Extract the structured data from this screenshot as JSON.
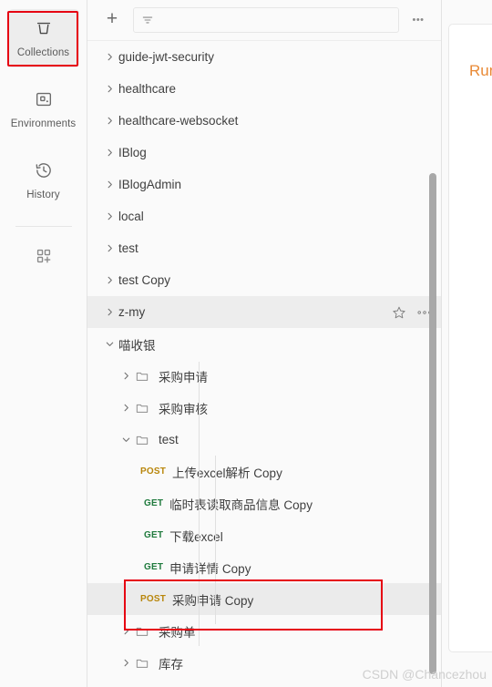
{
  "rail": {
    "items": [
      {
        "label": "Collections",
        "icon": "collections-icon",
        "active": true,
        "annotated": true
      },
      {
        "label": "Environments",
        "icon": "environments-icon",
        "active": false,
        "annotated": false
      },
      {
        "label": "History",
        "icon": "history-icon",
        "active": false,
        "annotated": false
      }
    ],
    "new_button": {
      "label": "",
      "icon": "new-grid-plus-icon"
    }
  },
  "toolbar": {
    "new_label": "+",
    "filter_placeholder": "",
    "filter_value": "",
    "filter_icon": "filter-icon",
    "more_label": "•••"
  },
  "tree": {
    "collections": [
      {
        "name": "guide-jwt-security",
        "expanded": false,
        "type": "collection"
      },
      {
        "name": "healthcare",
        "expanded": false,
        "type": "collection"
      },
      {
        "name": "healthcare-websocket",
        "expanded": false,
        "type": "collection"
      },
      {
        "name": "IBlog",
        "expanded": false,
        "type": "collection"
      },
      {
        "name": "IBlogAdmin",
        "expanded": false,
        "type": "collection"
      },
      {
        "name": "local",
        "expanded": false,
        "type": "collection"
      },
      {
        "name": "test",
        "expanded": false,
        "type": "collection"
      },
      {
        "name": "test Copy",
        "expanded": false,
        "type": "collection"
      },
      {
        "name": "z-my",
        "expanded": false,
        "type": "collection",
        "hovered": true,
        "actions": [
          "star-icon",
          "more-icon"
        ]
      },
      {
        "name": "喵收银",
        "expanded": true,
        "type": "collection"
      }
    ],
    "miaoshouyin_children": [
      {
        "name": "采购申请",
        "type": "folder",
        "expanded": false,
        "depth": 1
      },
      {
        "name": "采购审核",
        "type": "folder",
        "expanded": false,
        "depth": 1
      },
      {
        "name": "test",
        "type": "folder",
        "expanded": true,
        "depth": 1
      },
      {
        "name": "上传excel解析 Copy",
        "type": "request",
        "method": "POST",
        "depth": 2
      },
      {
        "name": "临时表读取商品信息 Copy",
        "type": "request",
        "method": "GET",
        "depth": 2
      },
      {
        "name": "下载excel",
        "type": "request",
        "method": "GET",
        "depth": 2
      },
      {
        "name": "申请详情 Copy",
        "type": "request",
        "method": "GET",
        "depth": 2
      },
      {
        "name": "采购申请 Copy",
        "type": "request",
        "method": "POST",
        "depth": 2,
        "selected": true,
        "annotated": true
      },
      {
        "name": "采购单",
        "type": "folder",
        "expanded": false,
        "depth": 1
      },
      {
        "name": "库存",
        "type": "folder",
        "expanded": false,
        "depth": 1
      }
    ]
  },
  "right_pane": {
    "card_title": "Run"
  },
  "watermark": {
    "text": "CSDN @Chancezhou"
  },
  "colors": {
    "accent_red": "#e60012",
    "method_get": "#1f7a3d",
    "method_post": "#b8860b",
    "run_orange": "#e98a36",
    "row_selected": "#ebebeb",
    "background": "#fafafa"
  }
}
